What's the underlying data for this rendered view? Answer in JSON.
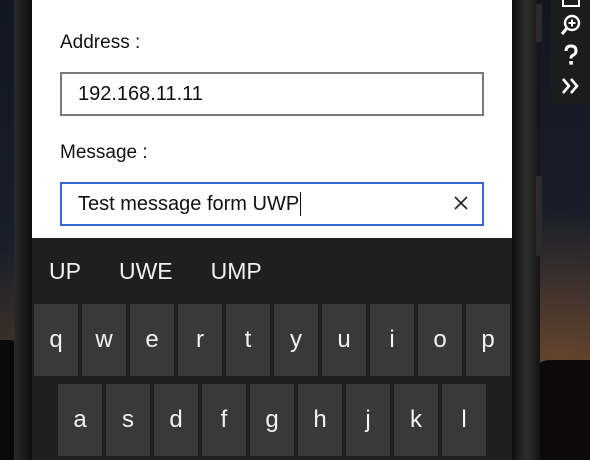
{
  "form": {
    "address_label": "Address :",
    "address_value": "192.168.11.11",
    "message_label": "Message :",
    "message_value": "Test message form UWP"
  },
  "keyboard": {
    "suggestions": [
      "UP",
      "UWE",
      "UMP"
    ],
    "row1": [
      "q",
      "w",
      "e",
      "r",
      "t",
      "y",
      "u",
      "i",
      "o",
      "p"
    ],
    "row2": [
      "a",
      "s",
      "d",
      "f",
      "g",
      "h",
      "j",
      "k",
      "l"
    ]
  },
  "toolbar": {
    "icons": [
      "fit-screen-icon",
      "zoom-icon",
      "help-icon",
      "additional-tools-icon"
    ]
  },
  "colors": {
    "focus_border": "#3a66d8",
    "keyboard_bg": "#1f1f1f",
    "key_bg": "#393939"
  }
}
